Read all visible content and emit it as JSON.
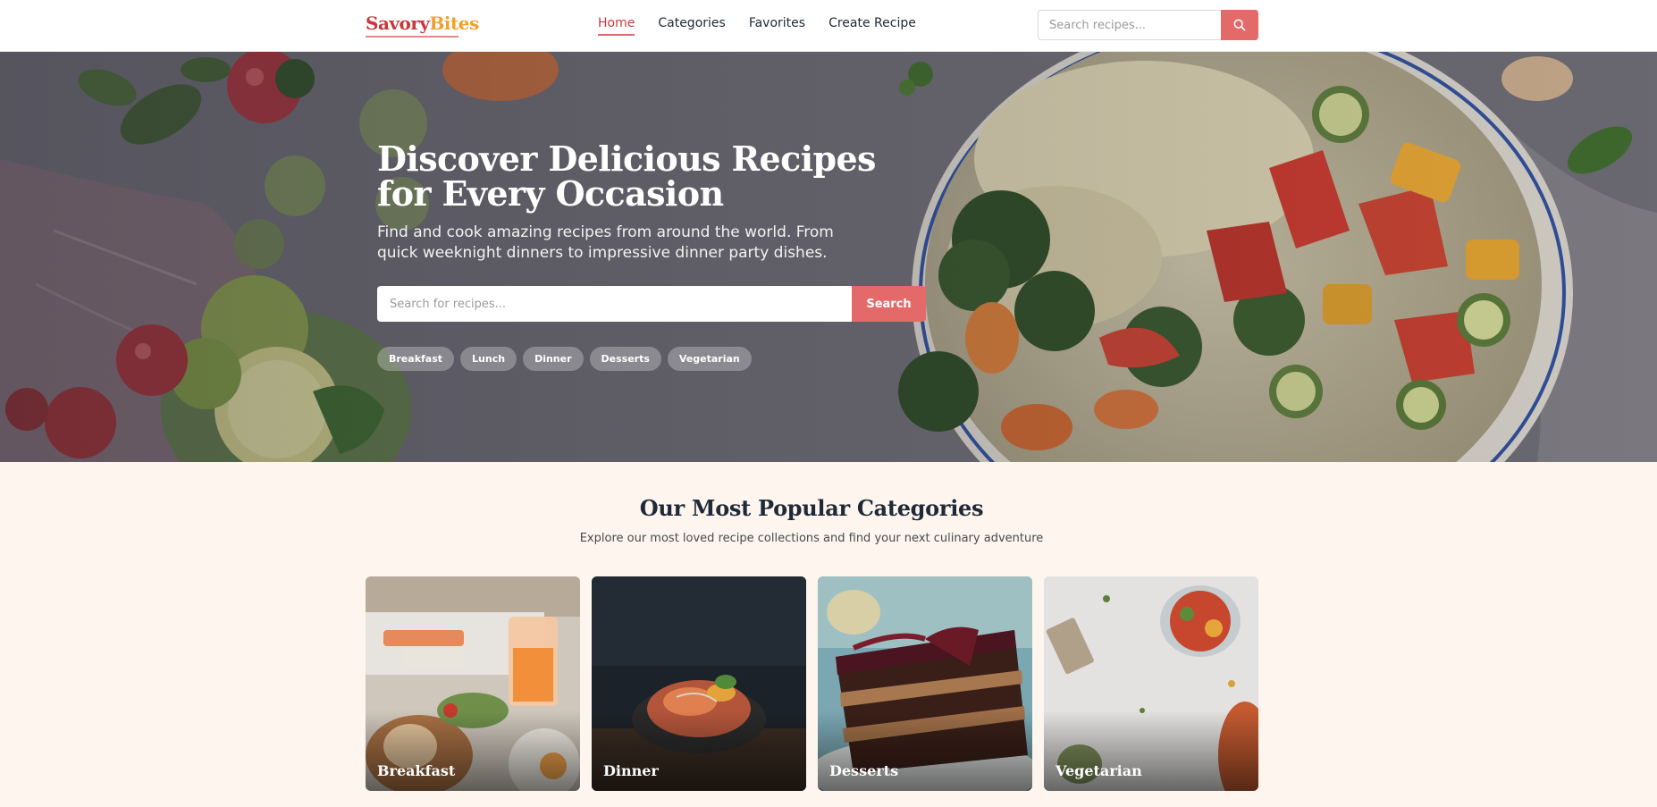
{
  "brand": {
    "name_part1": "Savory",
    "name_part2": "Bites"
  },
  "nav": {
    "links": [
      {
        "label": "Home",
        "active": true
      },
      {
        "label": "Categories",
        "active": false
      },
      {
        "label": "Favorites",
        "active": false
      },
      {
        "label": "Create Recipe",
        "active": false
      }
    ],
    "search_placeholder": "Search recipes...",
    "search_icon": "search-icon"
  },
  "hero": {
    "title": "Discover Delicious Recipes for Every Occasion",
    "subtitle": "Find and cook amazing recipes from around the world. From quick weeknight dinners to impressive dinner party dishes.",
    "search_placeholder": "Search for recipes...",
    "search_button": "Search",
    "tags": [
      "Breakfast",
      "Lunch",
      "Dinner",
      "Desserts",
      "Vegetarian"
    ]
  },
  "categories": {
    "title": "Our Most Popular Categories",
    "subtitle": "Explore our most loved recipe collections and find your next culinary adventure",
    "cards": [
      {
        "label": "Breakfast"
      },
      {
        "label": "Dinner"
      },
      {
        "label": "Desserts"
      },
      {
        "label": "Vegetarian"
      }
    ]
  },
  "colors": {
    "accent": "#e46a6a",
    "brand_red": "#c9373b",
    "brand_orange": "#f0a030",
    "section_bg": "#fdf5ee"
  }
}
